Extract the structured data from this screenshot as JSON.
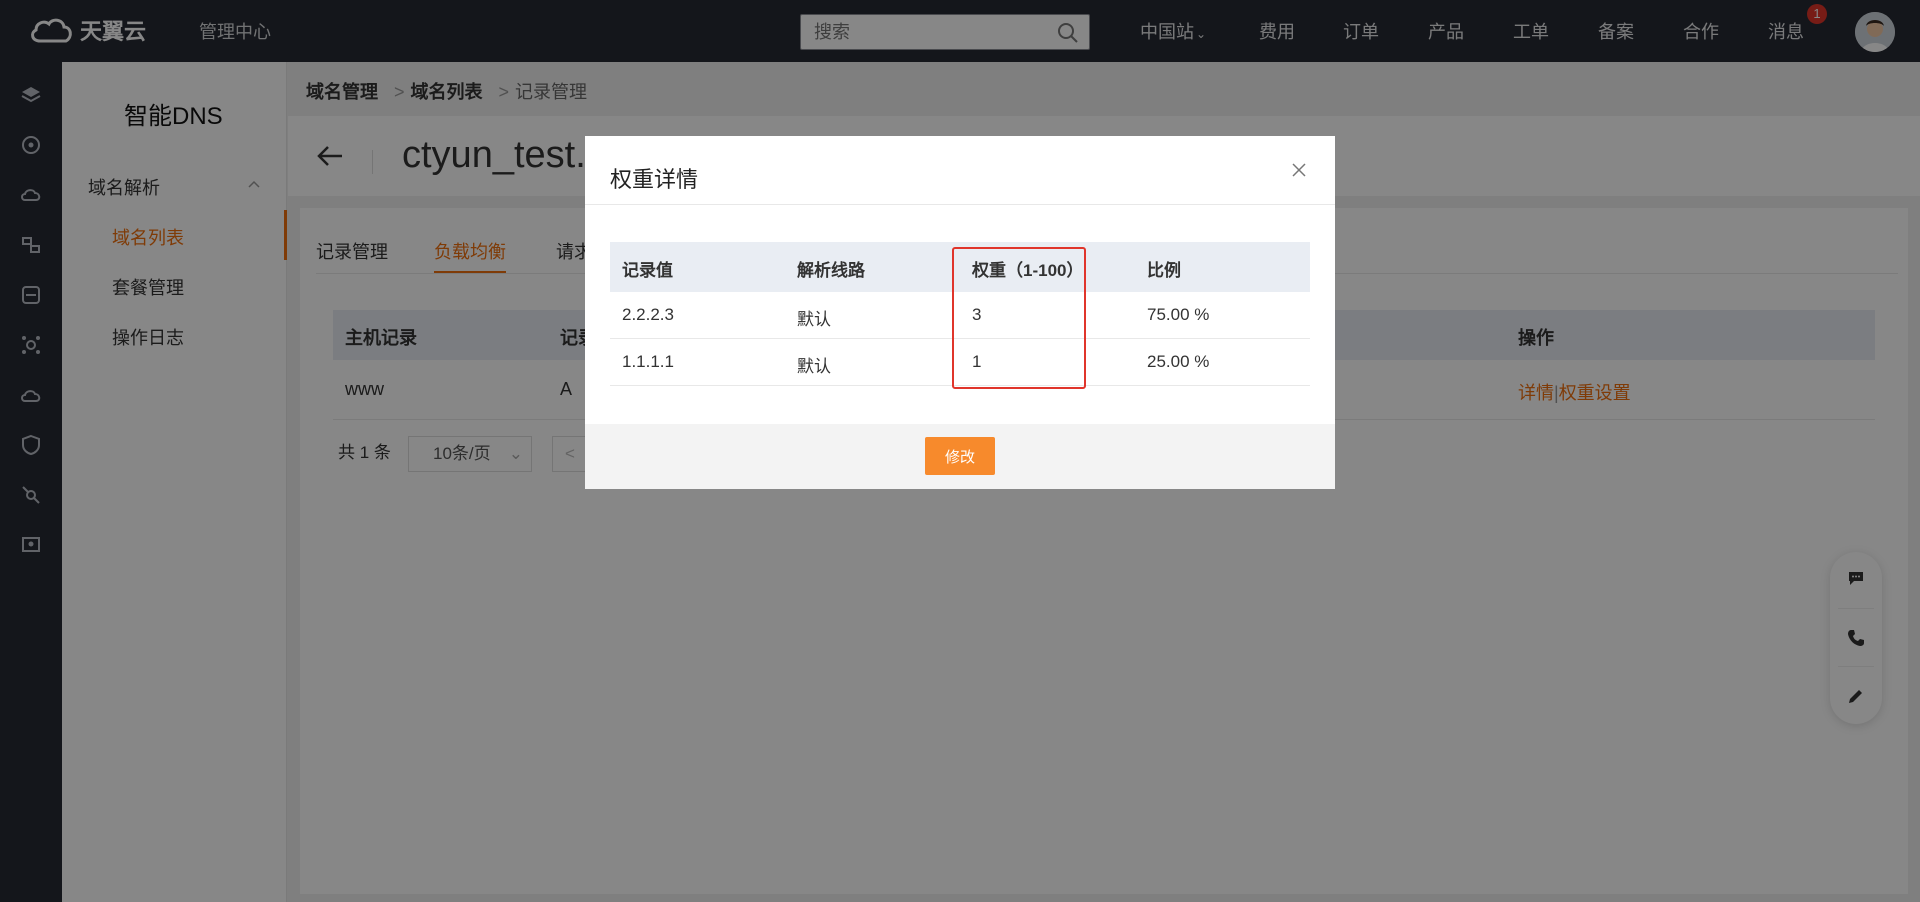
{
  "topbar": {
    "logo_text": "天翼云",
    "mgmt_center": "管理中心",
    "search_placeholder": "搜索",
    "nav": [
      "中国站",
      "费用",
      "订单",
      "产品",
      "工单",
      "备案",
      "合作",
      "消息"
    ],
    "message_badge": "1"
  },
  "rail_icons": [
    "layers-icon",
    "network-icon",
    "cloud-server-icon",
    "transfer-icon",
    "storage-icon",
    "settings-hub-icon",
    "cloud-sync-icon",
    "shield-icon",
    "link-icon",
    "monitor-icon"
  ],
  "sidebar": {
    "title": "智能DNS",
    "group_label": "域名解析",
    "items": [
      "域名列表",
      "套餐管理",
      "操作日志"
    ],
    "active_item": "域名列表"
  },
  "breadcrumb": [
    "域名管理",
    "域名列表",
    "记录管理"
  ],
  "page": {
    "domain_title": "ctyun_test.c",
    "tabs": [
      "记录管理",
      "负载均衡",
      "请求"
    ],
    "active_tab": "负载均衡"
  },
  "background_table": {
    "headers": [
      "主机记录",
      "记录",
      "操作"
    ],
    "row": {
      "host": "www",
      "type": "A",
      "action_detail": "详情",
      "action_sep": "|",
      "action_weight": "权重设置"
    }
  },
  "pagination": {
    "total": "共 1 条",
    "page_size": "10条/页",
    "prev": "<"
  },
  "modal": {
    "title": "权重详情",
    "headers": [
      "记录值",
      "解析线路",
      "权重（1-100）",
      "比例"
    ],
    "rows": [
      {
        "value": "2.2.2.3",
        "line": "默认",
        "weight": "3",
        "ratio": "75.00 %"
      },
      {
        "value": "1.1.1.1",
        "line": "默认",
        "weight": "1",
        "ratio": "25.00 %"
      }
    ],
    "modify_button": "修改"
  },
  "colors": {
    "accent": "#f0700e",
    "topbar_bg": "#262a33",
    "highlight": "#e0352b",
    "button": "#f78a2c"
  }
}
